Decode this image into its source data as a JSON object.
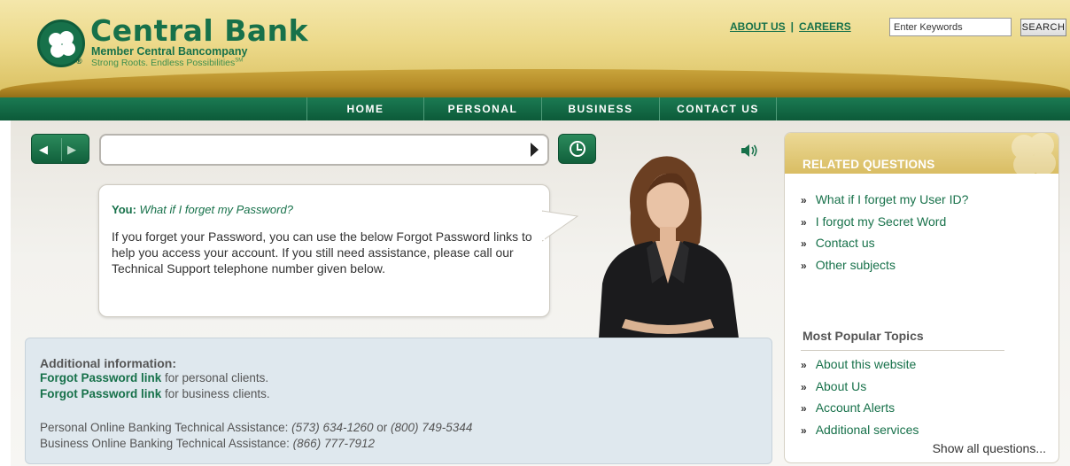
{
  "brand": {
    "name": "Central Bank",
    "subtitle": "Member Central Bancompany",
    "tagline": "Strong Roots. Endless Possibilities",
    "tagline_mark": "SM",
    "reg_mark": "®"
  },
  "header_links": {
    "about": "ABOUT US",
    "separator": "|",
    "careers": "CAREERS"
  },
  "search": {
    "value": "Enter Keywords",
    "button": "SEARCH"
  },
  "nav": {
    "items": [
      "HOME",
      "PERSONAL",
      "BUSINESS",
      "CONTACT US"
    ]
  },
  "conversation": {
    "speaker_label": "You:",
    "question": "What if I forget my Password?",
    "answer": "If you forget your Password, you can use the below Forgot Password links to help you access your account. If you still need assistance, please call our Technical Support telephone number given below."
  },
  "additional_info": {
    "title": "Additional information:",
    "personal_link": "Forgot Password link",
    "personal_suffix": " for personal clients.",
    "business_link": "Forgot Password link",
    "business_suffix": " for business clients.",
    "personal_support_label": "Personal Online Banking Technical Assistance: ",
    "personal_phone_1": "(573) 634-1260",
    "or_text": " or ",
    "personal_phone_2": "(800) 749-5344",
    "business_support_label": "Business Online Banking Technical Assistance: ",
    "business_phone": "(866) 777-7912"
  },
  "related": {
    "title": "RELATED QUESTIONS",
    "bullet": "»",
    "items": [
      "What if I forget my User ID?",
      "I forgot my Secret Word",
      "Contact us",
      "Other subjects"
    ],
    "popular_title": "Most Popular Topics",
    "popular_items": [
      "About this website",
      "About Us",
      "Account Alerts",
      "Additional services"
    ],
    "show_all": "Show all questions..."
  },
  "colors": {
    "brand_green": "#17714a",
    "header_gold": "#d9bf5f",
    "info_bg": "#dfe8ee"
  },
  "icons": {
    "back": "back-arrow-icon",
    "forward": "forward-arrow-icon",
    "submit": "play-icon",
    "history": "clock-icon",
    "audio": "speaker-icon"
  }
}
